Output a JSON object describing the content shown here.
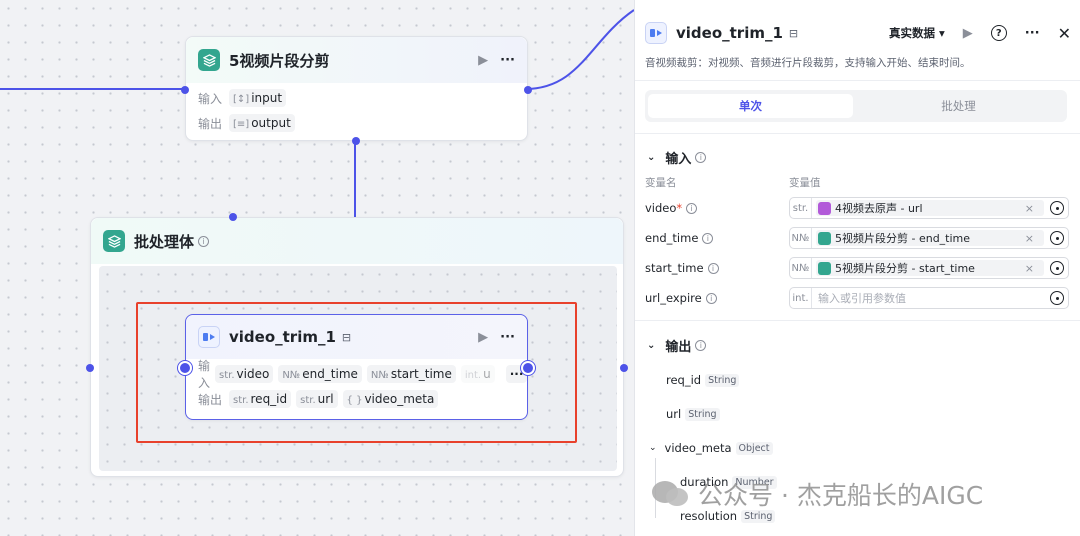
{
  "node_top": {
    "title": "5视频片段分剪",
    "input_label": "输入",
    "output_label": "输出",
    "input_param": "input",
    "output_param": "output"
  },
  "batch": {
    "title": "批处理体"
  },
  "node_inner": {
    "title": "video_trim_1",
    "input_label": "输入",
    "output_label": "输出",
    "inputs": [
      {
        "type": "str.",
        "name": "video"
      },
      {
        "type": "N№",
        "name": "end_time"
      },
      {
        "type": "N№",
        "name": "start_time"
      },
      {
        "type": "int.",
        "name": "u"
      }
    ],
    "outputs": [
      {
        "type": "str.",
        "name": "req_id"
      },
      {
        "type": "str.",
        "name": "url"
      },
      {
        "type": "{ }",
        "name": "video_meta"
      }
    ]
  },
  "panel": {
    "title": "video_trim_1",
    "data_select": "真实数据",
    "description": "音视频裁剪：对视频、音频进行片段裁剪，支持输入开始、结束时间。",
    "tabs": [
      "单次",
      "批处理"
    ],
    "input_section": "输入",
    "col_name": "变量名",
    "col_value": "变量值",
    "variables": [
      {
        "name": "video",
        "required": "*",
        "type": "str.",
        "ref": "4视频去原声 - url",
        "ref_color": "#b25ad9"
      },
      {
        "name": "end_time",
        "required": "",
        "type": "N№",
        "ref": "5视频片段分剪 - end_time",
        "ref_color": "#33a68f"
      },
      {
        "name": "start_time",
        "required": "",
        "type": "N№",
        "ref": "5视频片段分剪 - start_time",
        "ref_color": "#33a68f"
      },
      {
        "name": "url_expire",
        "required": "",
        "type": "int.",
        "placeholder": "输入或引用参数值"
      }
    ],
    "output_section": "输出",
    "outputs": [
      {
        "name": "req_id",
        "type": "String"
      },
      {
        "name": "url",
        "type": "String"
      },
      {
        "name": "video_meta",
        "type": "Object"
      },
      {
        "name": "duration",
        "type": "Number"
      },
      {
        "name": "resolution",
        "type": "String"
      }
    ]
  },
  "watermark": "公众号 · 杰克船长的AIGC",
  "colors": {
    "accent": "#4d53e8",
    "teal": "#33a68f",
    "highlight": "#e8412c"
  }
}
